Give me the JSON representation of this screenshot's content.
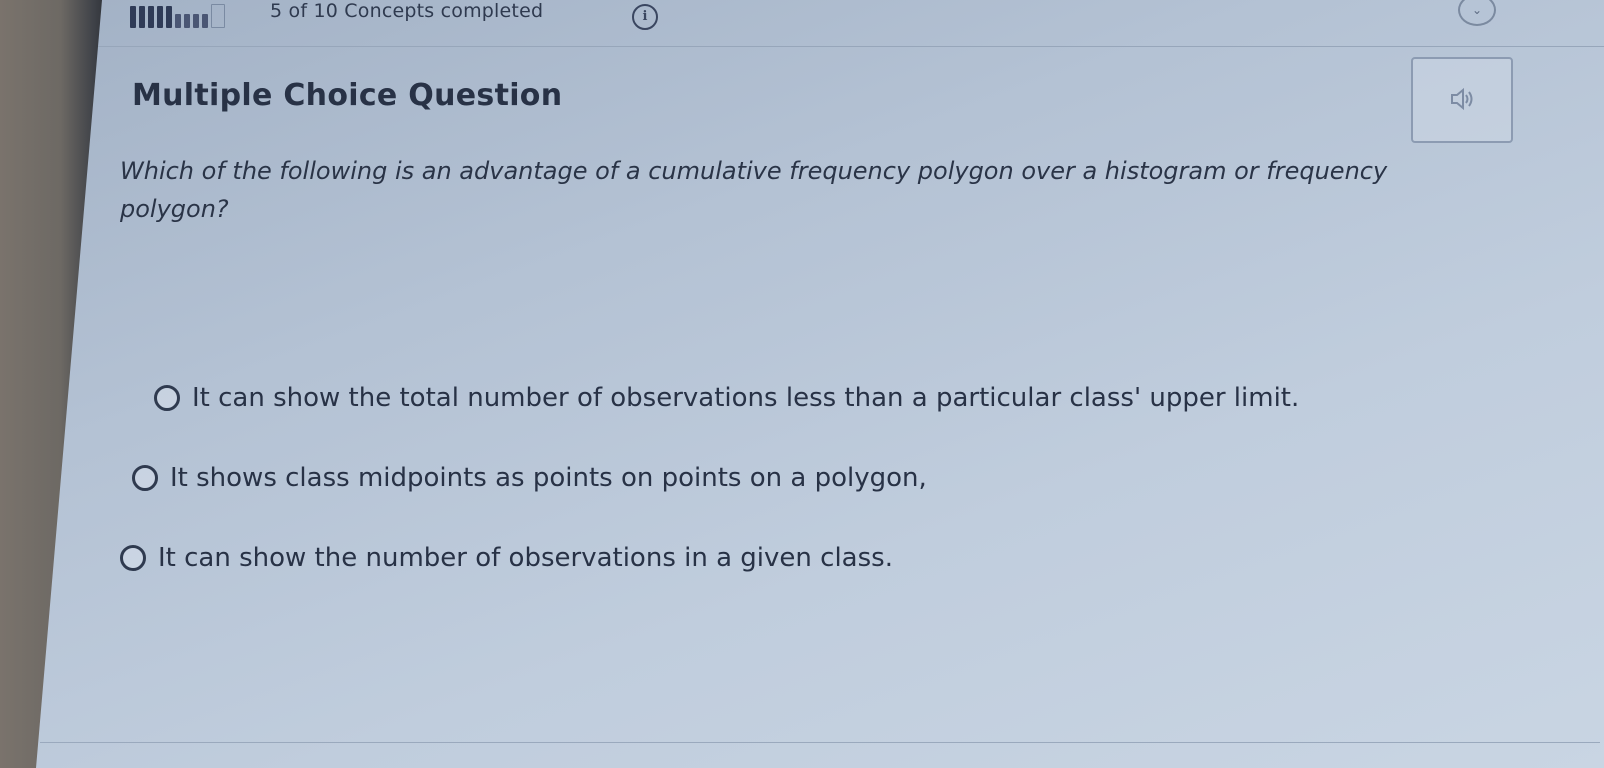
{
  "topbar": {
    "progress_text": "5 of 10 Concepts completed",
    "progress_completed": 5,
    "progress_total": 10,
    "info_icon": "info-icon",
    "info_glyph": "i"
  },
  "card": {
    "title": "Multiple Choice Question",
    "audio_icon": "speaker-icon"
  },
  "question": {
    "text": "Which of the following is an advantage of a cumulative frequency polygon over a histogram or frequency polygon?"
  },
  "options": [
    {
      "label": "It can show the total number of observations less than a particular class' upper limit.",
      "selected": false
    },
    {
      "label": "It shows class midpoints as points on points on a polygon,",
      "selected": false
    },
    {
      "label": "It can show the number of observations in a given class.",
      "selected": false
    }
  ],
  "colors": {
    "text": "#283246",
    "border": "#8c9bb2"
  }
}
